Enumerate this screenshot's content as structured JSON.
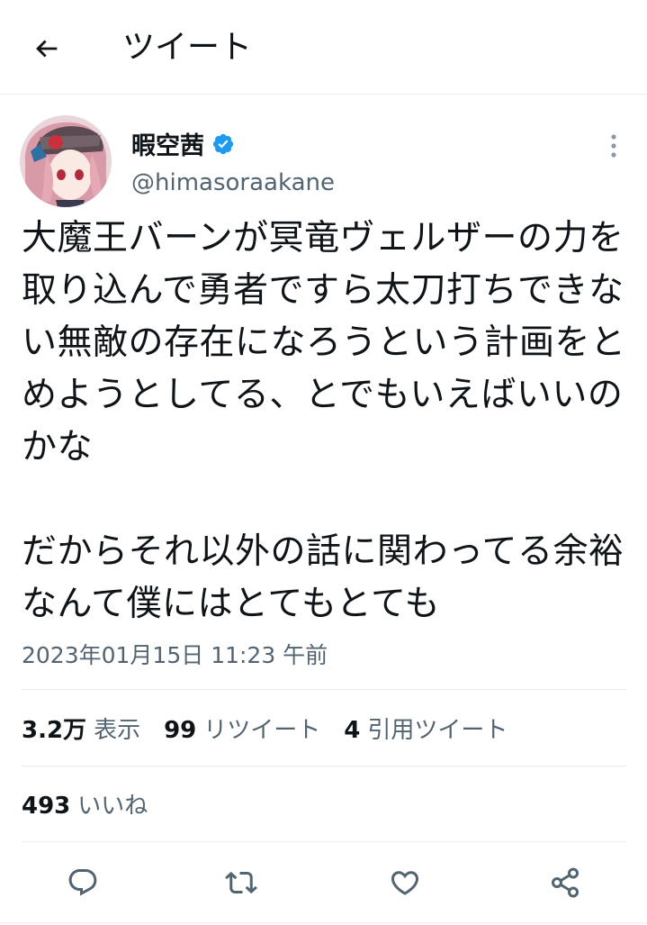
{
  "header": {
    "title": "ツイート",
    "back_icon": "arrow-left-icon"
  },
  "author": {
    "name": "暇空茜",
    "handle": "@himasoraakane",
    "verified": true,
    "verified_color": "#1d9bf0"
  },
  "tweet": {
    "text": "大魔王バーンが冥竜ヴェルザーの力を取り込んで勇者ですら太刀打ちできない無敵の存在になろうという計画をとめようとしてる、とでもいえばいいのかな\n\nだからそれ以外の話に関わってる余裕なんて僕にはとてもとても",
    "timestamp": "2023年01月15日 11:23 午前"
  },
  "stats": {
    "views_count": "3.2万",
    "views_label": "表示",
    "retweets_count": "99",
    "retweets_label": "リツイート",
    "quotes_count": "4",
    "quotes_label": "引用ツイート",
    "likes_count": "493",
    "likes_label": "いいね"
  },
  "actions": [
    "reply-icon",
    "retweet-icon",
    "like-icon",
    "share-icon"
  ],
  "colors": {
    "text": "#0f1419",
    "secondary": "#536471",
    "border": "#e6ecf0",
    "accent": "#1d9bf0"
  }
}
